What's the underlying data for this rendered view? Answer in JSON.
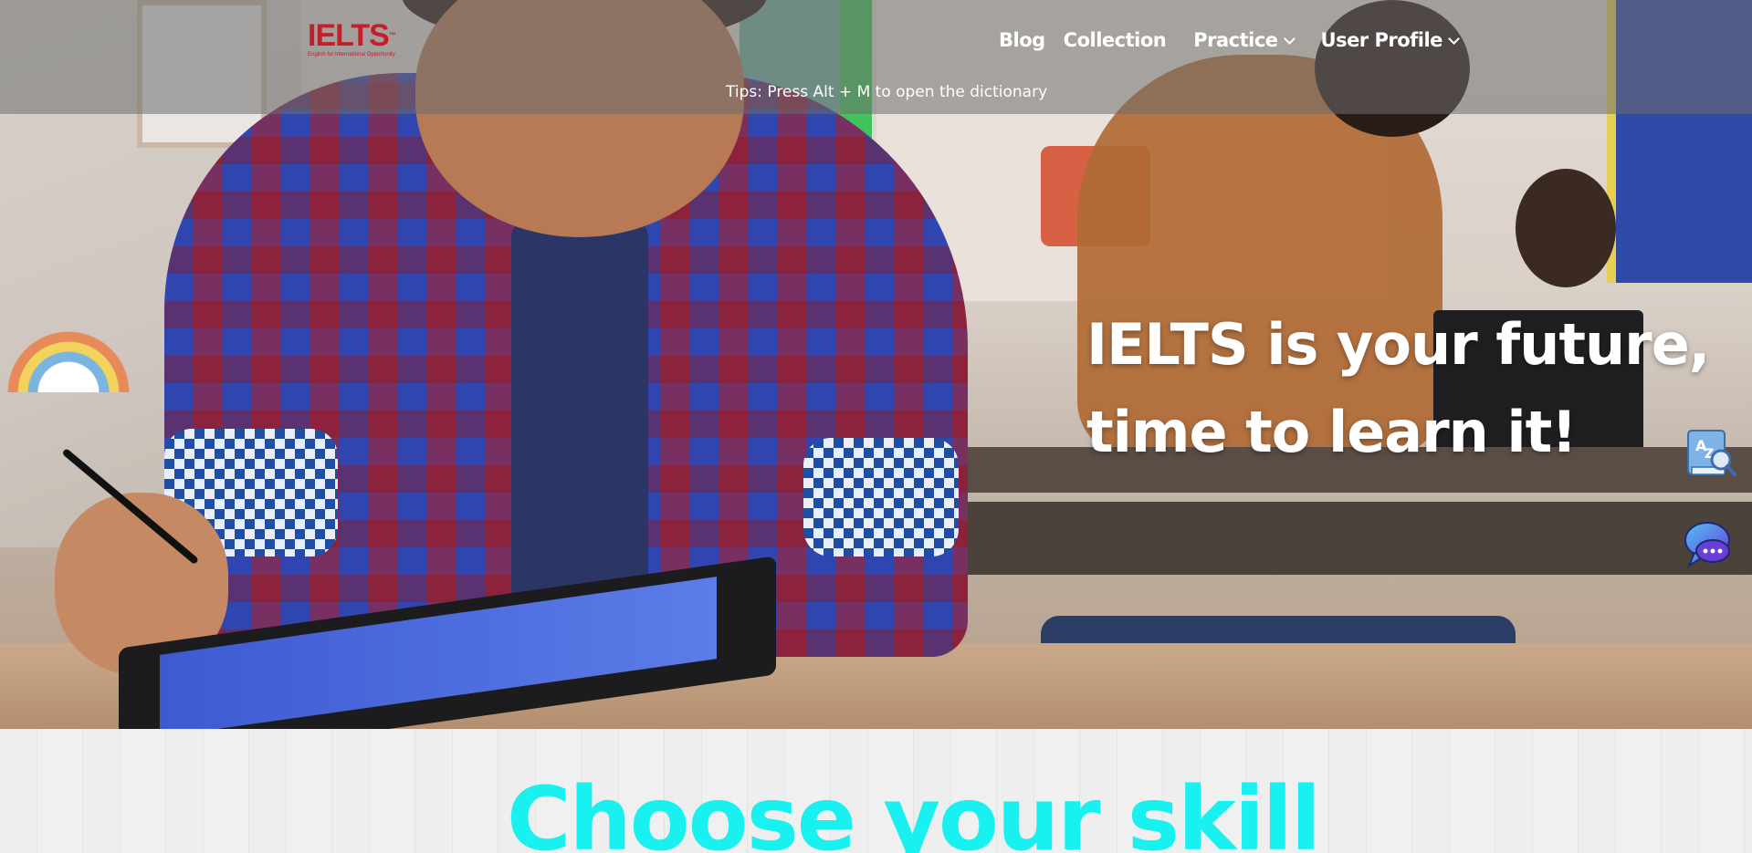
{
  "header": {
    "logo": {
      "text": "IELTS",
      "tagline": "English for International Opportunity"
    },
    "nav": [
      {
        "label": "Blog",
        "has_dropdown": false
      },
      {
        "label": "Collection",
        "has_dropdown": false
      },
      {
        "label": "Practice",
        "has_dropdown": true
      },
      {
        "label": "User Profile",
        "has_dropdown": true
      }
    ],
    "tips": "Tips: Press Alt + M to open the dictionary"
  },
  "hero": {
    "headline_line1": "IELTS is your future,",
    "headline_line2": "time to learn it!"
  },
  "floating_buttons": {
    "dictionary_icon": "dictionary-az-magnifier-icon",
    "chat_icon": "chat-bubbles-icon"
  },
  "skills": {
    "title": "Choose your skill"
  },
  "colors": {
    "logo_red": "#c41e2a",
    "skill_title_cyan": "#19f0f0",
    "header_overlay": "rgba(110,110,110,0.55)"
  }
}
